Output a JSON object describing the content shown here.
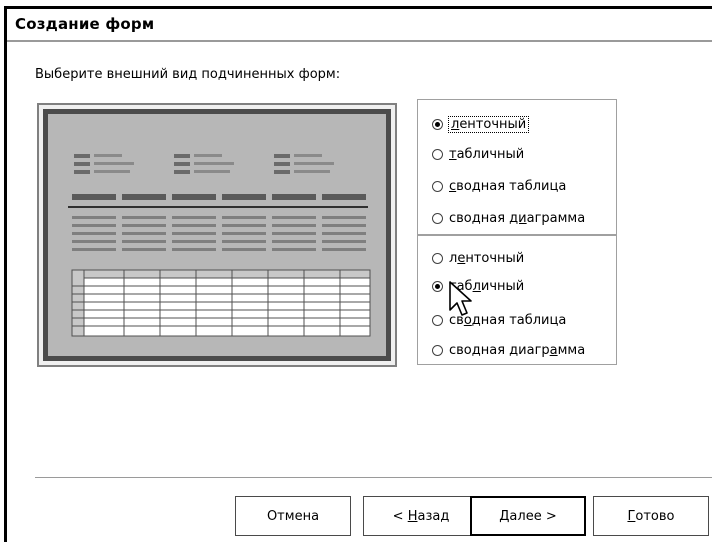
{
  "window": {
    "title": "Создание форм"
  },
  "prompt": "Выберите внешний вид подчиненных форм:",
  "group1": {
    "options": [
      {
        "label_pre": "",
        "label_ul": "л",
        "label_post": "енточный",
        "selected": true
      },
      {
        "label_pre": "",
        "label_ul": "т",
        "label_post": "абличный",
        "selected": false
      },
      {
        "label_pre": "",
        "label_ul": "с",
        "label_post": "водная таблица",
        "selected": false
      },
      {
        "label_pre": "сводная ",
        "label_ul": "ди",
        "label_post": "аграмма",
        "selected": false
      }
    ]
  },
  "group2": {
    "options": [
      {
        "label_pre": "л",
        "label_ul": "е",
        "label_post": "нточный",
        "selected": false
      },
      {
        "label_pre": "таб",
        "label_ul": "л",
        "label_post": "ичный",
        "selected": true
      },
      {
        "label_pre": "св",
        "label_ul": "о",
        "label_post": "дная таблица",
        "selected": false
      },
      {
        "label_pre": "сводная диагр",
        "label_ul": "а",
        "label_post": "мма",
        "selected": false
      }
    ]
  },
  "buttons": {
    "cancel": "Отмена",
    "back_pre": "< ",
    "back_ul": "Н",
    "back_post": "азад",
    "next_ul": "Д",
    "next_post": "алее >",
    "finish_ul": "Г",
    "finish_post": "отово"
  }
}
